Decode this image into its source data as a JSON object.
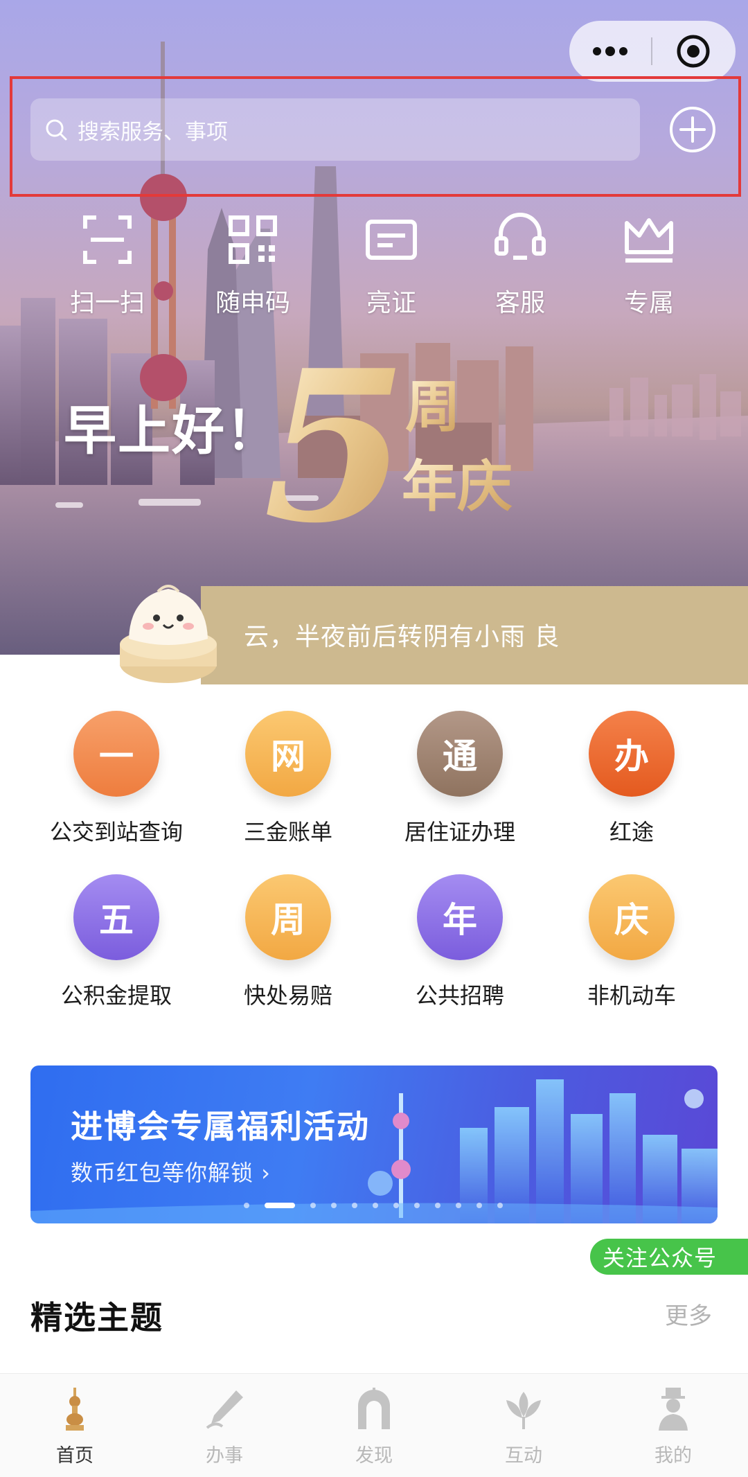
{
  "header": {
    "search_placeholder": "搜索服务、事项",
    "icons": {
      "search": "search-icon",
      "add": "plus-circle-icon",
      "more": "more-dots-icon",
      "close": "target-icon"
    }
  },
  "quick_actions": [
    {
      "label": "扫一扫",
      "icon": "scan-icon"
    },
    {
      "label": "随申码",
      "icon": "qr-code-icon"
    },
    {
      "label": "亮证",
      "icon": "card-icon"
    },
    {
      "label": "客服",
      "icon": "headset-icon"
    },
    {
      "label": "专属",
      "icon": "crown-icon"
    }
  ],
  "greeting": "早上好！",
  "anniversary": {
    "numeral": "5",
    "text_line1": "周",
    "text_line2": "年庆"
  },
  "weather_text": "云，半夜前后转阴有小雨 良",
  "services": [
    {
      "label": "公交到站查询",
      "glyph": "一",
      "color": "#f0874a"
    },
    {
      "label": "三金账单",
      "glyph": "网",
      "color": "#f5b24e"
    },
    {
      "label": "居住证办理",
      "glyph": "通",
      "color": "#9a7e6a"
    },
    {
      "label": "红途",
      "glyph": "办",
      "color": "#ec6a2a"
    },
    {
      "label": "公积金提取",
      "glyph": "五",
      "color": "#8a6de6"
    },
    {
      "label": "快处易赔",
      "glyph": "周",
      "color": "#f5b24e"
    },
    {
      "label": "公共招聘",
      "glyph": "年",
      "color": "#8a6de6"
    },
    {
      "label": "非机动车",
      "glyph": "庆",
      "color": "#f5b24e"
    }
  ],
  "banner": {
    "title": "进博会专属福利活动",
    "subtitle": "数币红包等你解锁 ›"
  },
  "follow_label": "关注公众号",
  "section": {
    "title": "精选主题",
    "more": "更多"
  },
  "tabs": [
    {
      "label": "首页",
      "icon": "pagoda-icon",
      "active": true
    },
    {
      "label": "办事",
      "icon": "pen-icon",
      "active": false
    },
    {
      "label": "发现",
      "icon": "arch-icon",
      "active": false
    },
    {
      "label": "互动",
      "icon": "flower-icon",
      "active": false
    },
    {
      "label": "我的",
      "icon": "person-icon",
      "active": false
    }
  ]
}
